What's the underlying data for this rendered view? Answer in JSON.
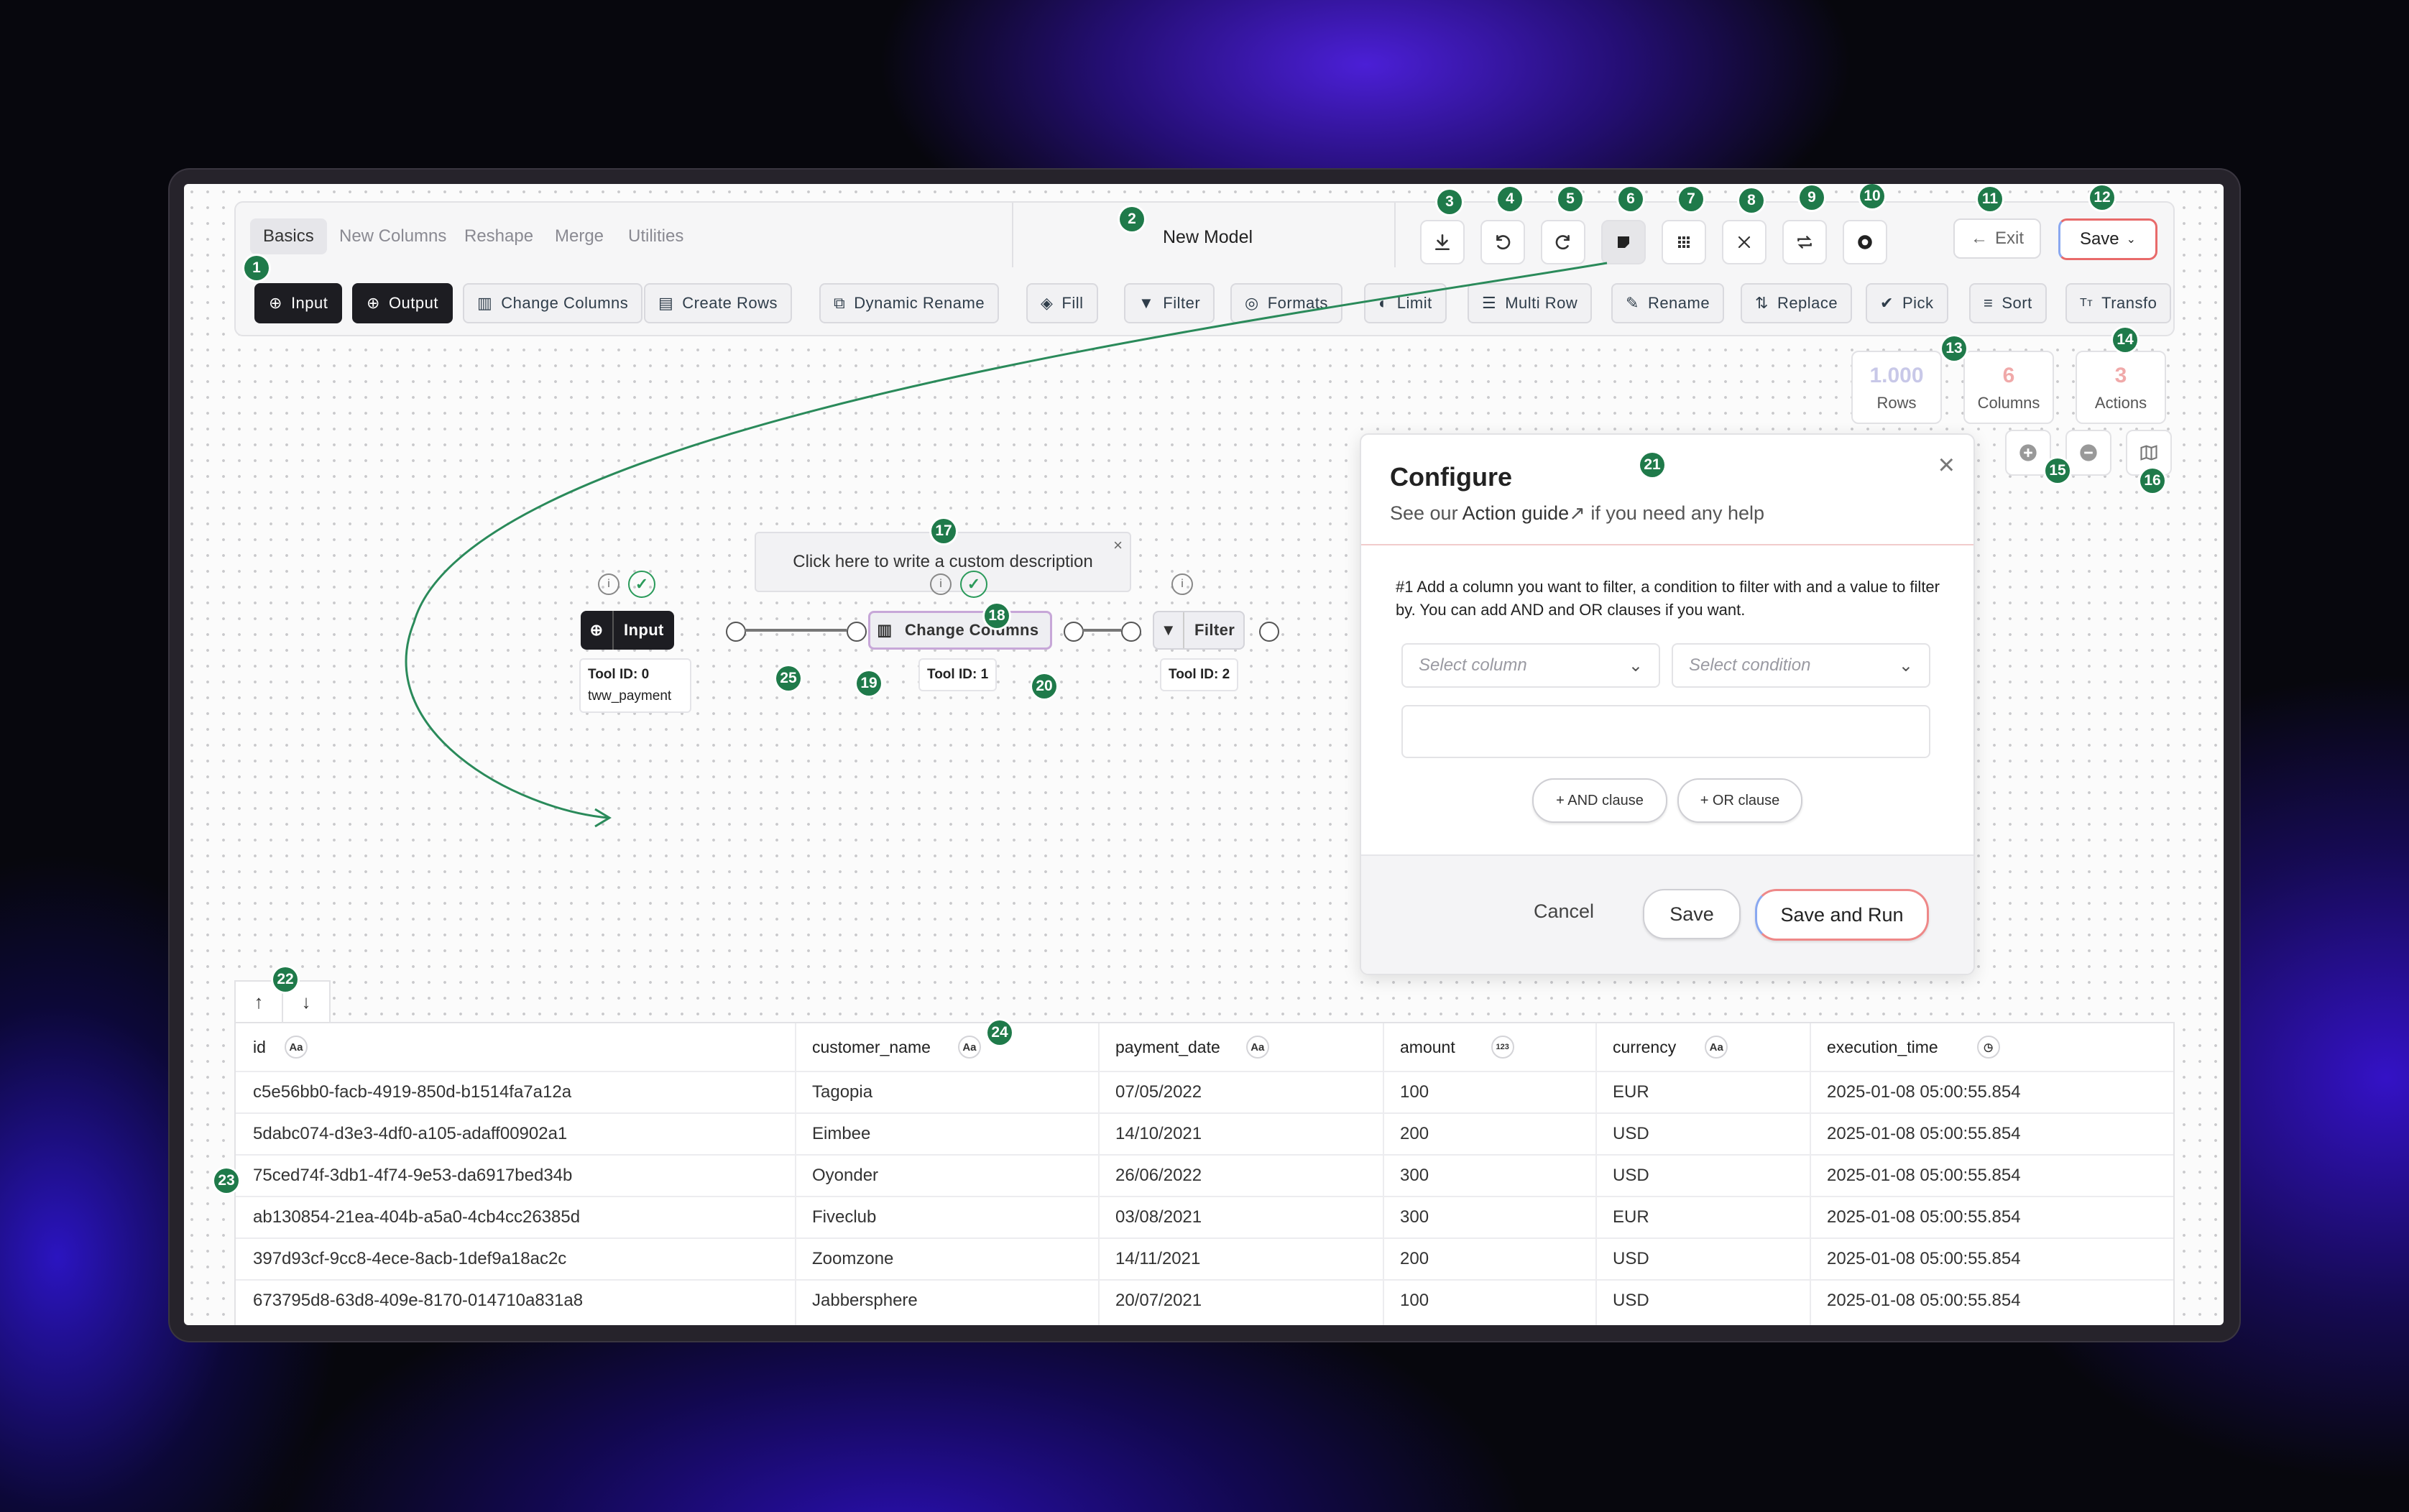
{
  "tabs": [
    "Basics",
    "New Columns",
    "Reshape",
    "Merge",
    "Utilities"
  ],
  "model_name": "New Model",
  "exit_label": "Exit",
  "save_label": "Save",
  "toolbar_tools": [
    "Input",
    "Output",
    "Change Columns",
    "Create Rows",
    "Dynamic Rename",
    "Fill",
    "Filter",
    "Formats",
    "Limit",
    "Multi Row",
    "Rename",
    "Replace",
    "Pick",
    "Sort",
    "Transfo"
  ],
  "stats": {
    "rows_value": "1.000",
    "rows_label": "Rows",
    "columns_value": "6",
    "columns_label": "Columns",
    "actions_value": "3",
    "actions_label": "Actions"
  },
  "canvas": {
    "description_placeholder": "Click here to write a custom description",
    "nodes": [
      {
        "label": "Input",
        "tool_id": "Tool ID: 0",
        "source": "tww_payment"
      },
      {
        "label": "Change Columns",
        "tool_id": "Tool ID: 1"
      },
      {
        "label": "Filter",
        "tool_id": "Tool ID: 2"
      }
    ]
  },
  "configure": {
    "title": "Configure",
    "subtitle_prefix": "See our ",
    "guide_link": "Action guide",
    "subtitle_suffix": " if you need any help",
    "instruction": "#1 Add a column you want to filter, a condition to filter with and a value to filter by. You can add AND and OR clauses if you want.",
    "select_column_placeholder": "Select column",
    "select_condition_placeholder": "Select condition",
    "and_clause": "+ AND clause",
    "or_clause": "+ OR clause",
    "cancel": "Cancel",
    "save": "Save",
    "save_and_run": "Save and Run"
  },
  "table": {
    "columns": [
      {
        "name": "id",
        "type": "Aa"
      },
      {
        "name": "customer_name",
        "type": "Aa"
      },
      {
        "name": "payment_date",
        "type": "Aa"
      },
      {
        "name": "amount",
        "type": "123"
      },
      {
        "name": "currency",
        "type": "Aa"
      },
      {
        "name": "execution_time",
        "type": "clock"
      }
    ],
    "rows": [
      [
        "c5e56bb0-facb-4919-850d-b1514fa7a12a",
        "Tagopia",
        "07/05/2022",
        "100",
        "EUR",
        "2025-01-08 05:00:55.854"
      ],
      [
        "5dabc074-d3e3-4df0-a105-adaff00902a1",
        "Eimbee",
        "14/10/2021",
        "200",
        "USD",
        "2025-01-08 05:00:55.854"
      ],
      [
        "75ced74f-3db1-4f74-9e53-da6917bed34b",
        "Oyonder",
        "26/06/2022",
        "300",
        "USD",
        "2025-01-08 05:00:55.854"
      ],
      [
        "ab130854-21ea-404b-a5a0-4cb4cc26385d",
        "Fiveclub",
        "03/08/2021",
        "300",
        "EUR",
        "2025-01-08 05:00:55.854"
      ],
      [
        "397d93cf-9cc8-4ece-8acb-1def9a18ac2c",
        "Zoomzone",
        "14/11/2021",
        "200",
        "USD",
        "2025-01-08 05:00:55.854"
      ],
      [
        "673795d8-63d8-409e-8170-014710a831a8",
        "Jabbersphere",
        "20/07/2021",
        "100",
        "USD",
        "2025-01-08 05:00:55.854"
      ]
    ]
  },
  "annotations": [
    "1",
    "2",
    "3",
    "4",
    "5",
    "6",
    "7",
    "8",
    "9",
    "10",
    "11",
    "12",
    "13",
    "14",
    "15",
    "16",
    "17",
    "18",
    "19",
    "20",
    "21",
    "22",
    "23",
    "24",
    "25"
  ],
  "colors": {
    "accent_green": "#1f7a4a",
    "dark_chip": "#1d1d22",
    "save_ring": "#e86a6a",
    "stat_number": "#f0a9a9",
    "chat": "#2f8de4"
  }
}
